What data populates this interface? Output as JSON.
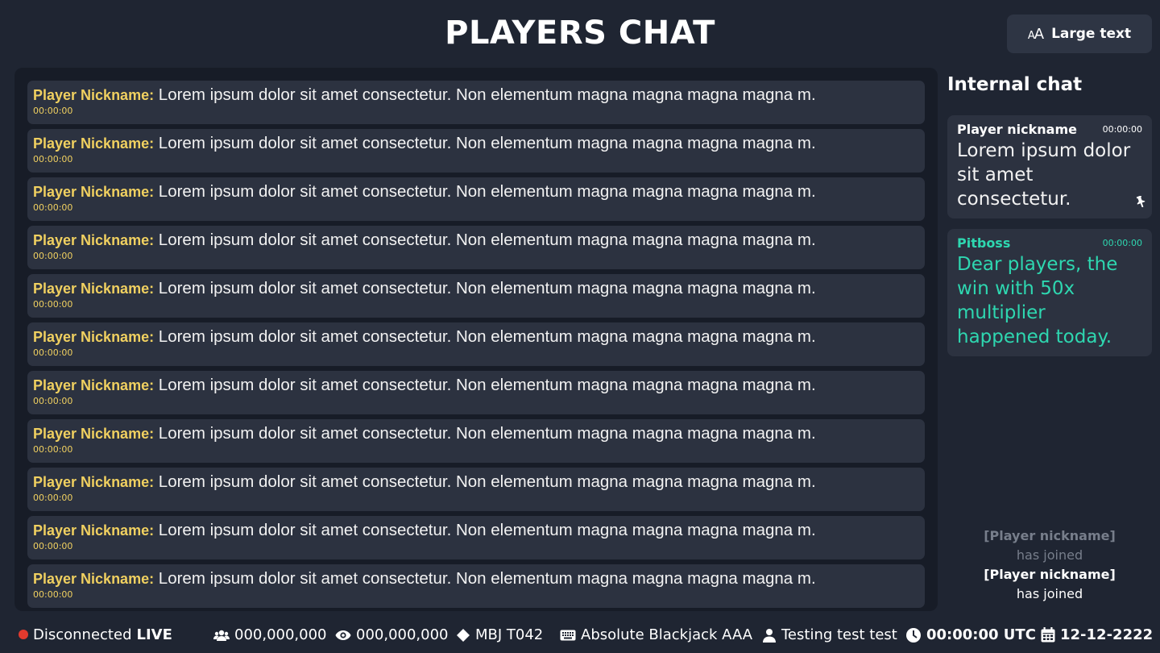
{
  "header": {
    "title": "PLAYERS CHAT",
    "large_text_label": "Large text"
  },
  "players_chat": {
    "messages": [
      {
        "nick": "Player Nickname:",
        "text": "Lorem ipsum dolor sit amet consectetur. Non elementum magna magna magna magna m.",
        "time": "00:00:00"
      },
      {
        "nick": "Player Nickname:",
        "text": "Lorem ipsum dolor sit amet consectetur. Non elementum magna magna magna magna m.",
        "time": "00:00:00"
      },
      {
        "nick": "Player Nickname:",
        "text": "Lorem ipsum dolor sit amet consectetur. Non elementum magna magna magna magna m.",
        "time": "00:00:00"
      },
      {
        "nick": "Player Nickname:",
        "text": "Lorem ipsum dolor sit amet consectetur. Non elementum magna magna magna magna m.",
        "time": "00:00:00"
      },
      {
        "nick": "Player Nickname:",
        "text": "Lorem ipsum dolor sit amet consectetur. Non elementum magna magna magna magna m.",
        "time": "00:00:00"
      },
      {
        "nick": "Player Nickname:",
        "text": "Lorem ipsum dolor sit amet consectetur. Non elementum magna magna magna magna m.",
        "time": "00:00:00"
      },
      {
        "nick": "Player Nickname:",
        "text": "Lorem ipsum dolor sit amet consectetur. Non elementum magna magna magna magna m.",
        "time": "00:00:00"
      },
      {
        "nick": "Player Nickname:",
        "text": "Lorem ipsum dolor sit amet consectetur. Non elementum magna magna magna magna m.",
        "time": "00:00:00"
      },
      {
        "nick": "Player Nickname:",
        "text": "Lorem ipsum dolor sit amet consectetur. Non elementum magna magna magna magna m.",
        "time": "00:00:00"
      },
      {
        "nick": "Player Nickname:",
        "text": "Lorem ipsum dolor sit amet consectetur. Non elementum magna magna magna magna m.",
        "time": "00:00:00"
      },
      {
        "nick": "Player Nickname:",
        "text": "Lorem ipsum dolor sit amet consectetur. Non elementum magna magna magna magna m.",
        "time": "00:00:00"
      }
    ]
  },
  "internal_chat": {
    "title": "Internal chat",
    "messages": [
      {
        "name": "Player nickname",
        "time": "00:00:00",
        "text": "Lorem ipsum dolor sit amet consectetur."
      },
      {
        "name": "Pitboss",
        "time": "00:00:00",
        "text": "Dear players, the win with 50x multiplier happened today."
      }
    ],
    "events": [
      {
        "nick": "[Player nickname]",
        "action": "has joined"
      },
      {
        "nick": "[Player nickname]",
        "action": "has joined"
      }
    ]
  },
  "status_bar": {
    "connection": "Disconnected",
    "live": "LIVE",
    "players_count": "000,000,000",
    "viewers_count": "000,000,000",
    "table_id": "MBJ T042",
    "game_name": "Absolute Blackjack AAA",
    "dealer": "Testing test test",
    "time": "00:00:00 UTC",
    "date": "12-12-2222"
  },
  "colors": {
    "nick": "#f0d060",
    "pitboss": "#2ed7b0",
    "live_dot": "#e23a2e",
    "background": "#1f2532"
  }
}
